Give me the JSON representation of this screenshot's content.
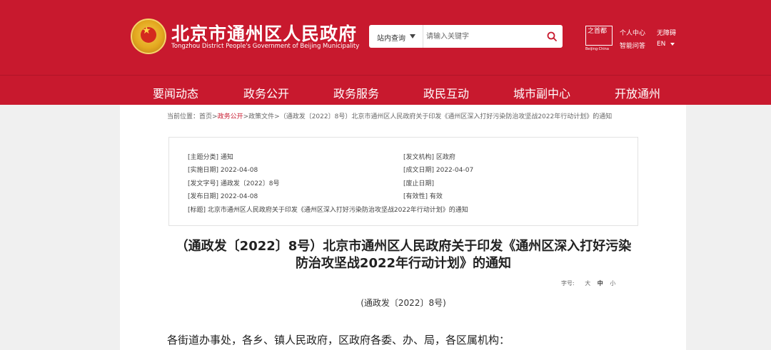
{
  "header": {
    "title": "北京市通州区人民政府",
    "subtitle": "Tongzhou District People's Government of Beijing Municipality",
    "search": {
      "scope_label": "站内查询",
      "placeholder": "请输入关键字"
    },
    "beijing_logo": {
      "chars": "之首都",
      "en": "Beijing·China"
    },
    "links": {
      "personal_center": "个人中心",
      "accessibility": "无障碍",
      "smart_qa": "智能问答",
      "language": "EN"
    }
  },
  "nav": {
    "items": [
      "要闻动态",
      "政务公开",
      "政务服务",
      "政民互动",
      "城市副中心",
      "开放通州"
    ]
  },
  "breadcrumb": {
    "prefix": "当前位置：",
    "home": "首页",
    "sep1": ">",
    "level1": "政务公开",
    "sep2": ">",
    "level2": "政策文件",
    "sep3": ">",
    "current": "（通政发〔2022〕8号）北京市通州区人民政府关于印发《通州区深入打好污染防治攻坚战2022年行动计划》的通知"
  },
  "meta": {
    "topic": "[主题分类] 通知",
    "issuer": "[发文机构] 区政府",
    "effective_date": "[实施日期] 2022-04-08",
    "created_date": "[成文日期] 2022-04-07",
    "doc_no": "[发文字号] 通政发〔2022〕8号",
    "repeal_date": "[废止日期]",
    "publish_date": "[发布日期] 2022-04-08",
    "validity": "[有效性] 有效",
    "title": "[标题] 北京市通州区人民政府关于印发《通州区深入打好污染防治攻坚战2022年行动计划》的通知"
  },
  "document": {
    "title_line1": "（通政发〔2022〕8号）北京市通州区人民政府关于印发《通州区深入打好污染",
    "title_line2": "防治攻坚战2022年行动计划》的通知",
    "font_size_label": "字号:",
    "font_sizes": [
      "大",
      "中",
      "小"
    ],
    "number": "(通政发〔2022〕8号)",
    "salutation": "各街道办事处，各乡、镇人民政府，区政府各委、办、局，各区属机构："
  },
  "colors": {
    "brand_red": "#c8192e",
    "page_bg": "#f0f0f0"
  }
}
